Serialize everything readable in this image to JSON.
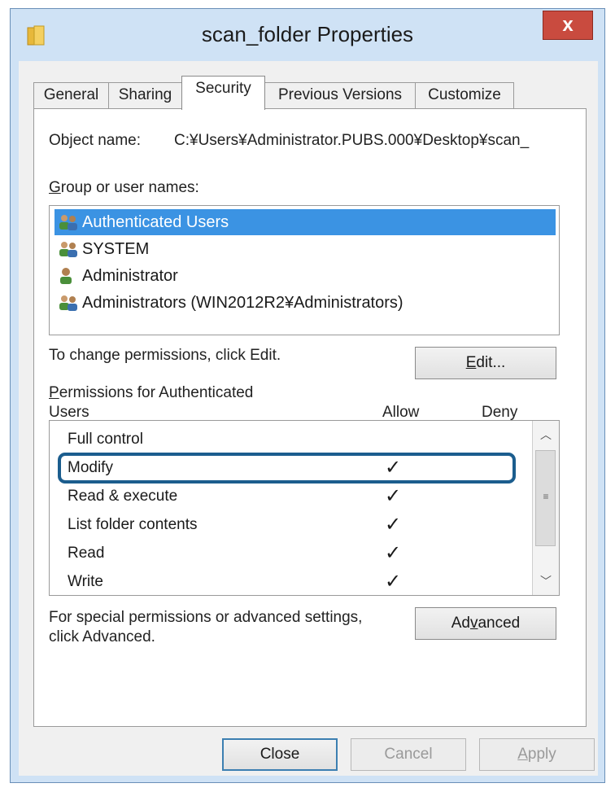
{
  "window": {
    "title": "scan_folder Properties",
    "close_glyph": "x"
  },
  "tabs": [
    {
      "label": "General"
    },
    {
      "label": "Sharing"
    },
    {
      "label": "Security",
      "active": true
    },
    {
      "label": "Previous Versions"
    },
    {
      "label": "Customize"
    }
  ],
  "security": {
    "object_name_label": "Object name:",
    "object_name_value": "C:¥Users¥Administrator.PUBS.000¥Desktop¥scan_",
    "group_label_mnemonic": "G",
    "group_label_rest": "roup or user names:",
    "users": [
      {
        "label": "Authenticated Users",
        "icon": "user-group-icon",
        "selected": true
      },
      {
        "label": "SYSTEM",
        "icon": "user-group-icon",
        "selected": false
      },
      {
        "label": "Administrator",
        "icon": "user-icon",
        "selected": false
      },
      {
        "label": "Administrators (WIN2012R2¥Administrators)",
        "icon": "user-group-icon",
        "selected": false
      }
    ],
    "change_hint": "To change permissions, click Edit.",
    "edit_mnemonic": "E",
    "edit_rest": "dit...",
    "permissions_label_mnemonic": "P",
    "permissions_label_line1_rest": "ermissions for Authenticated",
    "permissions_label_line2": "Users",
    "allow_header": "Allow",
    "deny_header": "Deny",
    "permissions": [
      {
        "name": "Full control",
        "allow": "",
        "deny": ""
      },
      {
        "name": "Modify",
        "allow": "✓",
        "deny": ""
      },
      {
        "name": "Read & execute",
        "allow": "✓",
        "deny": ""
      },
      {
        "name": "List folder contents",
        "allow": "✓",
        "deny": ""
      },
      {
        "name": "Read",
        "allow": "✓",
        "deny": ""
      },
      {
        "name": "Write",
        "allow": "✓",
        "deny": ""
      }
    ],
    "advanced_hint_line1": "For special permissions or advanced settings,",
    "advanced_hint_line2": "click Advanced.",
    "advanced_before": "Ad",
    "advanced_mnemonic": "v",
    "advanced_after": "anced"
  },
  "footer": {
    "close_label": "Close",
    "cancel_label": "Cancel",
    "apply_mnemonic": "A",
    "apply_rest": "pply"
  },
  "colors": {
    "selection": "#3b93e3",
    "highlight_outline": "#1b5d8e",
    "close_button": "#c94b3f"
  }
}
